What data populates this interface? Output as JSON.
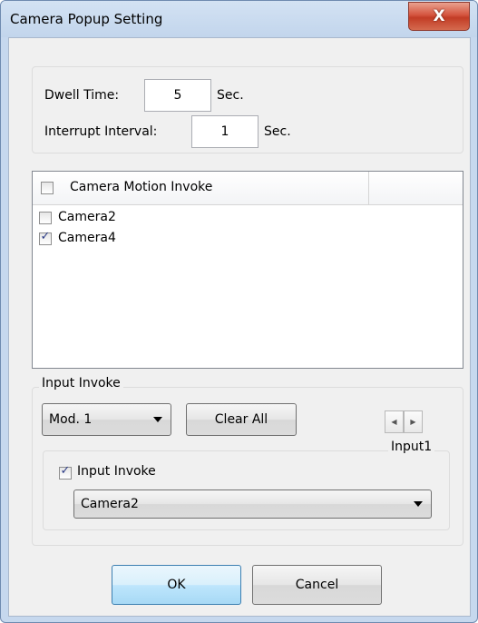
{
  "window": {
    "title": "Camera Popup Setting",
    "close_symbol": "X"
  },
  "timing": {
    "dwell_label": "Dwell Time:",
    "dwell_value": "5",
    "dwell_unit": "Sec.",
    "interrupt_label": "Interrupt Interval:",
    "interrupt_value": "1",
    "interrupt_unit": "Sec."
  },
  "motion_list": {
    "header_label": "Camera Motion Invoke",
    "header_checked": false,
    "items": [
      {
        "label": "Camera2",
        "checked": false
      },
      {
        "label": "Camera4",
        "checked": true
      }
    ]
  },
  "input_invoke": {
    "group_label": "Input Invoke",
    "module_selected": "Mod. 1",
    "clear_all_label": "Clear All",
    "spin_left_icon": "arrow-left",
    "spin_right_icon": "arrow-right",
    "input_group_label": "Input1",
    "enable_label": "Input Invoke",
    "enable_checked": true,
    "camera_selected": "Camera2"
  },
  "footer": {
    "ok_label": "OK",
    "cancel_label": "Cancel"
  },
  "colors": {
    "frame": "#c6d8ee",
    "close_button": "#c9452d",
    "focus_border": "#3c7fb1"
  }
}
